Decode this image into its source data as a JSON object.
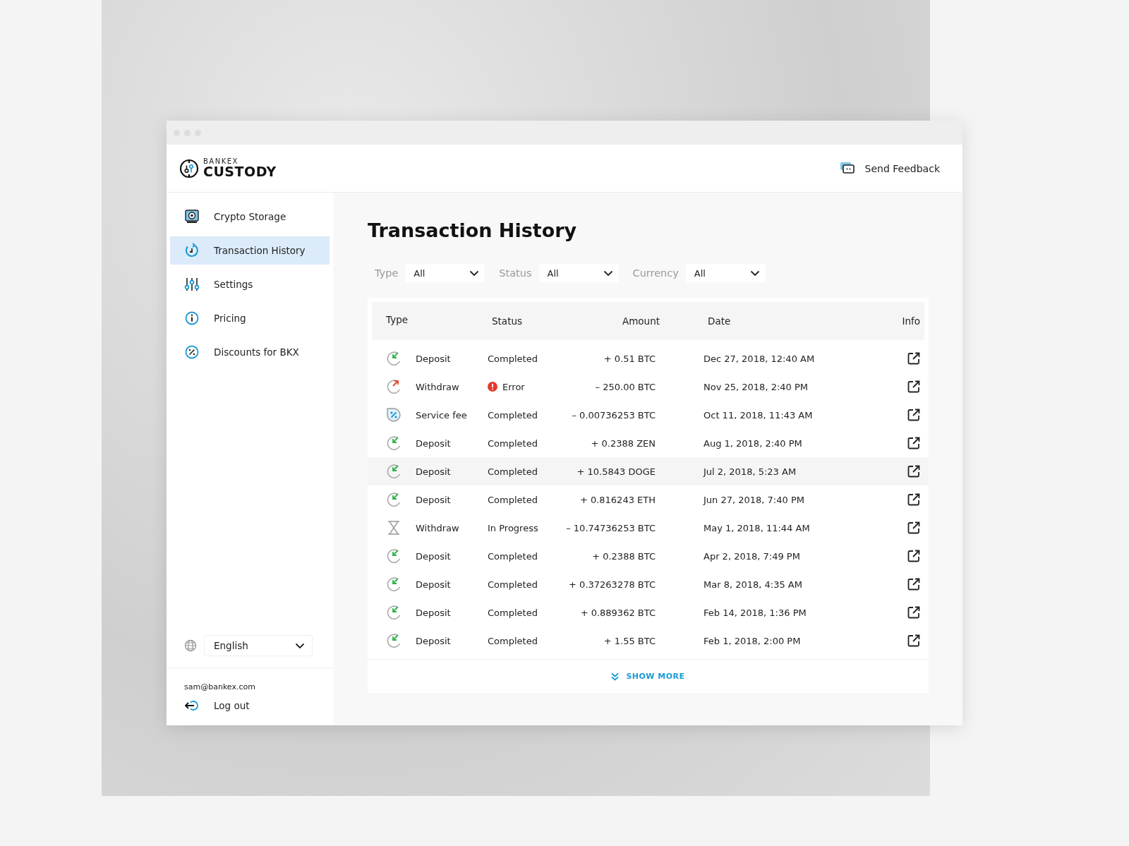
{
  "brand": {
    "top": "BANKEX",
    "bottom": "CUSTODY"
  },
  "header": {
    "feedback": "Send Feedback"
  },
  "sidebar": {
    "items": [
      {
        "label": "Crypto Storage",
        "selected": false
      },
      {
        "label": "Transaction History",
        "selected": true
      },
      {
        "label": "Settings",
        "selected": false
      },
      {
        "label": "Pricing",
        "selected": false
      },
      {
        "label": "Discounts for BKX",
        "selected": false
      }
    ],
    "language": "English",
    "email": "sam@bankex.com",
    "logout": "Log out"
  },
  "page": {
    "title": "Transaction History"
  },
  "filters": [
    {
      "label": "Type",
      "value": "All"
    },
    {
      "label": "Status",
      "value": "All"
    },
    {
      "label": "Currency",
      "value": "All"
    }
  ],
  "table": {
    "columns": [
      "Type",
      "Status",
      "Amount",
      "Date",
      "Info"
    ],
    "rows": [
      {
        "kind": "deposit",
        "type": "Deposit",
        "status": "Completed",
        "error": false,
        "amount": "+ 0.51 BTC",
        "date": "Dec 27, 2018, 12:40 AM",
        "hovered": false
      },
      {
        "kind": "withdraw",
        "type": "Withdraw",
        "status": "Error",
        "error": true,
        "amount": "– 250.00 BTC",
        "date": "Nov 25, 2018, 2:40 PM",
        "hovered": false
      },
      {
        "kind": "fee",
        "type": "Service fee",
        "status": "Completed",
        "error": false,
        "amount": "– 0.00736253 BTC",
        "date": "Oct 11, 2018, 11:43 AM",
        "hovered": false
      },
      {
        "kind": "deposit",
        "type": "Deposit",
        "status": "Completed",
        "error": false,
        "amount": "+ 0.2388 ZEN",
        "date": "Aug 1, 2018, 2:40 PM",
        "hovered": false
      },
      {
        "kind": "deposit",
        "type": "Deposit",
        "status": "Completed",
        "error": false,
        "amount": "+ 10.5843 DOGE",
        "date": "Jul 2, 2018, 5:23 AM",
        "hovered": true
      },
      {
        "kind": "deposit",
        "type": "Deposit",
        "status": "Completed",
        "error": false,
        "amount": "+ 0.816243 ETH",
        "date": "Jun 27, 2018, 7:40 PM",
        "hovered": false
      },
      {
        "kind": "pending",
        "type": "Withdraw",
        "status": "In Progress",
        "error": false,
        "amount": "– 10.74736253 BTC",
        "date": "May 1, 2018, 11:44 AM",
        "hovered": false
      },
      {
        "kind": "deposit",
        "type": "Deposit",
        "status": "Completed",
        "error": false,
        "amount": "+ 0.2388 BTC",
        "date": "Apr 2, 2018, 7:49 PM",
        "hovered": false
      },
      {
        "kind": "deposit",
        "type": "Deposit",
        "status": "Completed",
        "error": false,
        "amount": "+ 0.37263278 BTC",
        "date": "Mar 8, 2018, 4:35 AM",
        "hovered": false
      },
      {
        "kind": "deposit",
        "type": "Deposit",
        "status": "Completed",
        "error": false,
        "amount": "+ 0.889362 BTC",
        "date": "Feb 14, 2018, 1:36 PM",
        "hovered": false
      },
      {
        "kind": "deposit",
        "type": "Deposit",
        "status": "Completed",
        "error": false,
        "amount": "+ 1.55 BTC",
        "date": "Feb 1, 2018, 2:00 PM",
        "hovered": false
      }
    ],
    "show_more": "SHOW MORE"
  }
}
